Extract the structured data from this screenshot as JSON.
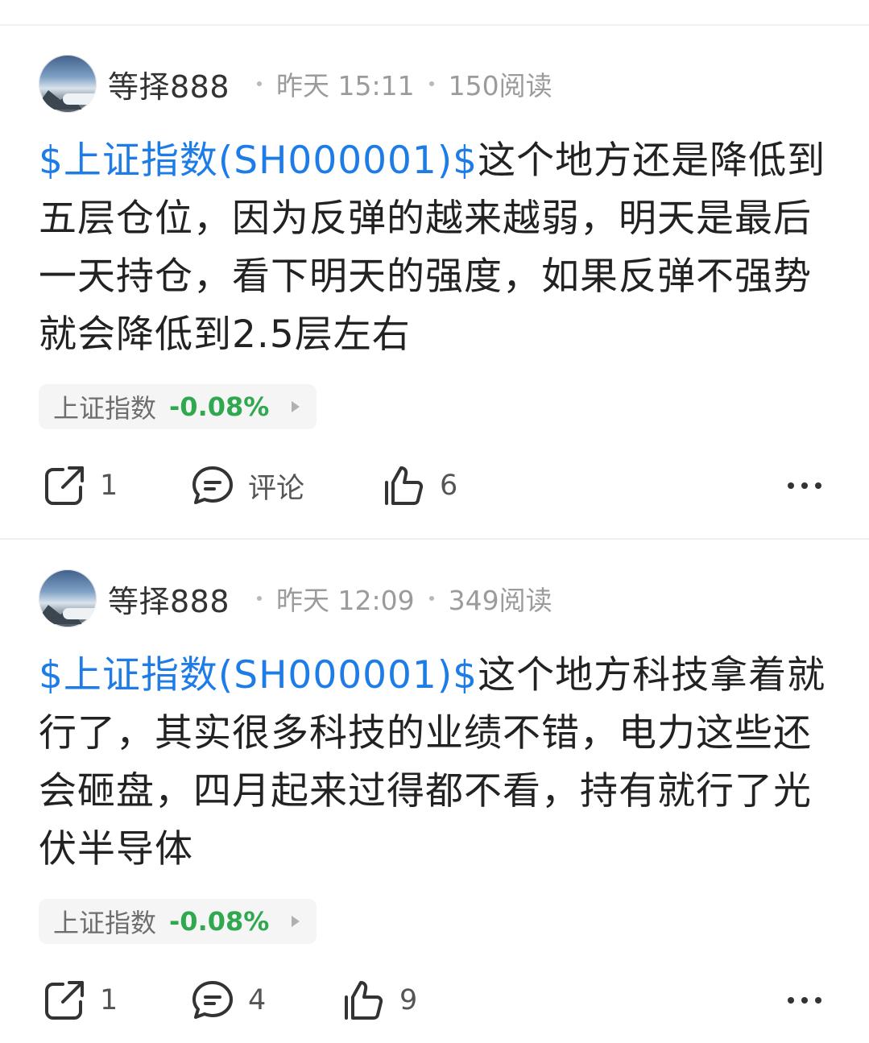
{
  "posts": [
    {
      "author": "等择888",
      "time": "昨天 15:11",
      "reads": "150阅读",
      "stock_link": "$上证指数(SH000001)$",
      "text": "这个地方还是降低到五层仓位，因为反弹的越来越弱，明天是最后一天持仓，看下明天的强度，如果反弹不强势就会降低到2.5层左右",
      "quote": {
        "name": "上证指数",
        "change": "-0.08%"
      },
      "actions": {
        "share": "1",
        "comment": "评论",
        "like": "6"
      }
    },
    {
      "author": "等择888",
      "time": "昨天 12:09",
      "reads": "349阅读",
      "stock_link": "$上证指数(SH000001)$",
      "text": "这个地方科技拿着就行了，其实很多科技的业绩不错，电力这些还会砸盘，四月起来过得都不看，持有就行了光伏半导体",
      "quote": {
        "name": "上证指数",
        "change": "-0.08%"
      },
      "actions": {
        "share": "1",
        "comment": "4",
        "like": "9"
      }
    }
  ],
  "colors": {
    "link": "#1e7ce6",
    "down": "#2fa84f",
    "meta": "#9b9b9b"
  }
}
